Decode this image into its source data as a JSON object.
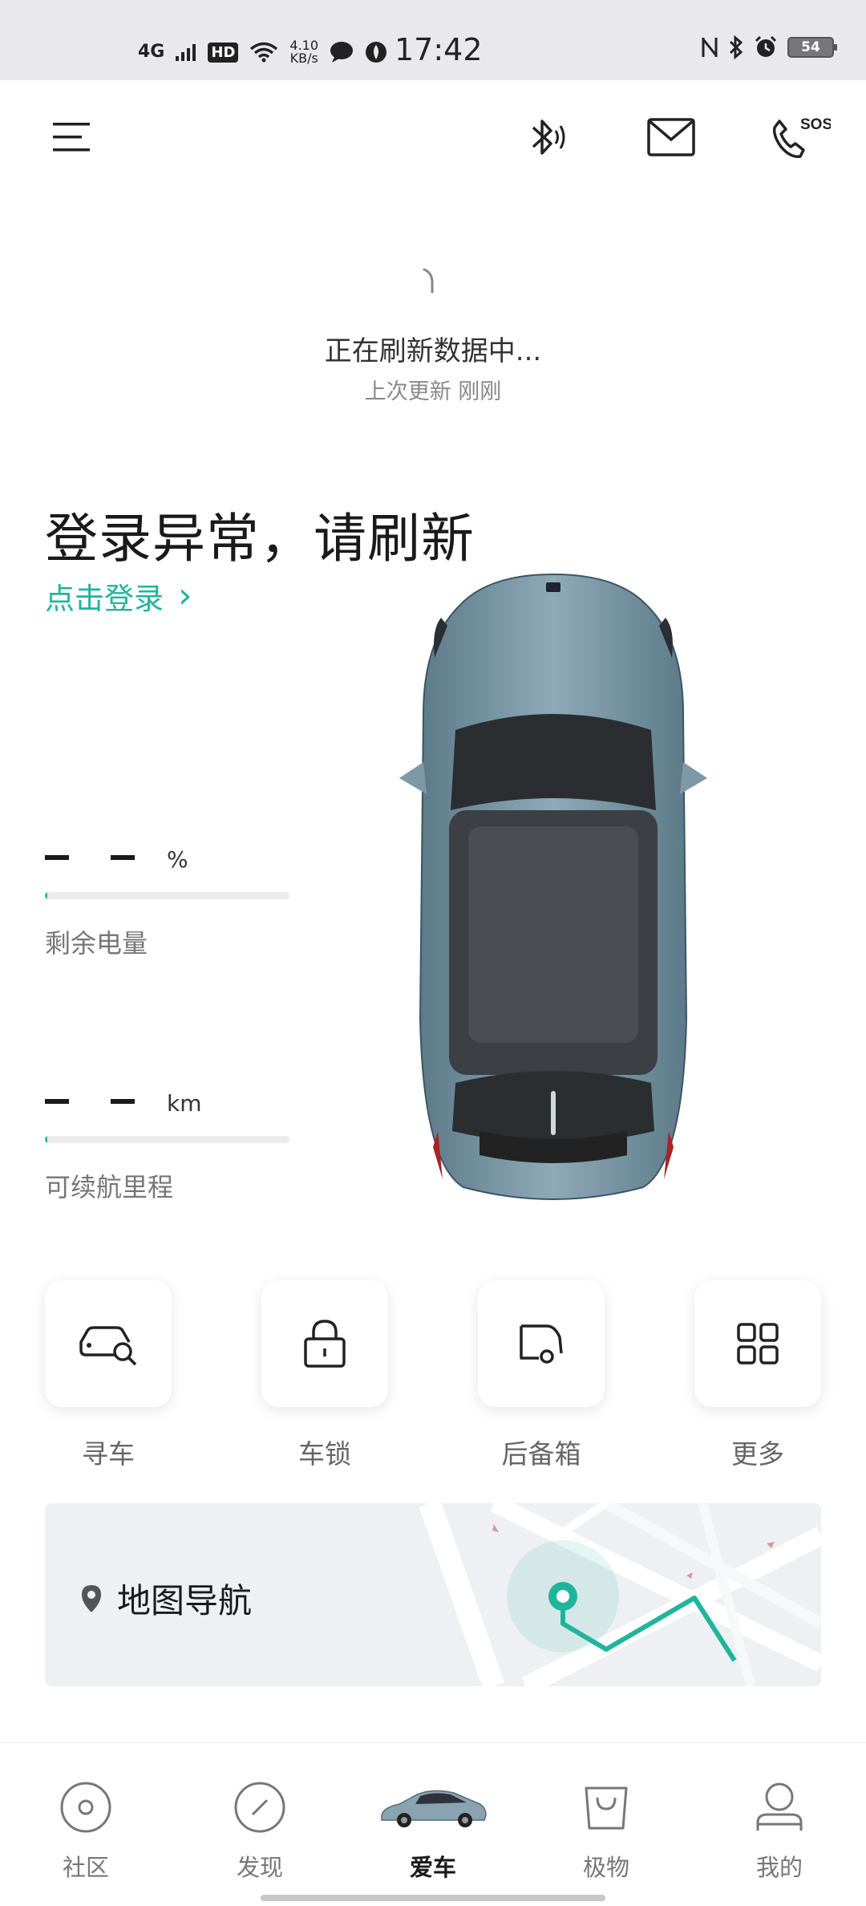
{
  "status_bar": {
    "network": "4G",
    "hd": "HD",
    "speed_value": "4.10",
    "speed_unit": "KB/s",
    "time": "17:42",
    "battery": "54"
  },
  "header": {
    "menu_icon": "menu-icon",
    "bluetooth_icon": "bluetooth-key-icon",
    "mail_icon": "mail-icon",
    "sos_label": "SOS"
  },
  "refresh": {
    "text": "正在刷新数据中...",
    "last_update": "上次更新 刚刚"
  },
  "login": {
    "title": "登录异常，请刷新",
    "link": "点击登录",
    "link_arrow": "›"
  },
  "stats": [
    {
      "dashes": "- -",
      "unit": "%",
      "label": "剩余电量",
      "fill_fraction": 0.01
    },
    {
      "dashes": "- -",
      "unit": "km",
      "label": "可续航里程",
      "fill_fraction": 0.01
    }
  ],
  "actions": [
    {
      "label": "寻车",
      "icon": "find-car-icon"
    },
    {
      "label": "车锁",
      "icon": "lock-icon"
    },
    {
      "label": "后备箱",
      "icon": "trunk-icon"
    },
    {
      "label": "更多",
      "icon": "grid-icon"
    }
  ],
  "map": {
    "title": "地图导航",
    "icon": "location-pin-icon"
  },
  "tabs": [
    {
      "label": "社区",
      "icon": "community-icon",
      "active": false
    },
    {
      "label": "发现",
      "icon": "compass-icon",
      "active": false
    },
    {
      "label": "爱车",
      "icon": "car-icon",
      "active": true
    },
    {
      "label": "极物",
      "icon": "shopping-bag-icon",
      "active": false
    },
    {
      "label": "我的",
      "icon": "profile-icon",
      "active": false
    }
  ],
  "colors": {
    "accent": "#1fb59c",
    "status_bar_bg": "#e9e9ec",
    "car_body": "#6f8e9e"
  }
}
